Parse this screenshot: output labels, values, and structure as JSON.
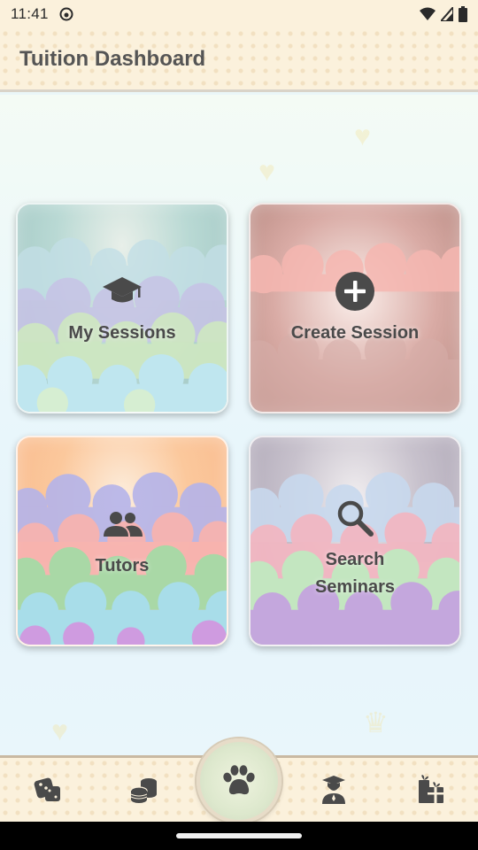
{
  "status_bar": {
    "time": "11:41"
  },
  "app_bar": {
    "title": "Tuition Dashboard"
  },
  "tiles": [
    {
      "label": "My Sessions",
      "icon": "graduation-cap-icon"
    },
    {
      "label": "Create Session",
      "icon": "plus-circle-icon"
    },
    {
      "label": "Tutors",
      "icon": "people-group-icon"
    },
    {
      "label": "Search Seminars",
      "icon": "search-icon"
    }
  ],
  "bottom_nav": {
    "items": [
      {
        "icon": "dice-icon"
      },
      {
        "icon": "coins-icon"
      },
      {
        "icon": "paw-icon"
      },
      {
        "icon": "graduate-student-icon"
      },
      {
        "icon": "gifts-icon"
      }
    ]
  },
  "colors": {
    "background": "#eaf6f8",
    "bar": "#fbf1dc",
    "icon": "#4a4a4a"
  }
}
